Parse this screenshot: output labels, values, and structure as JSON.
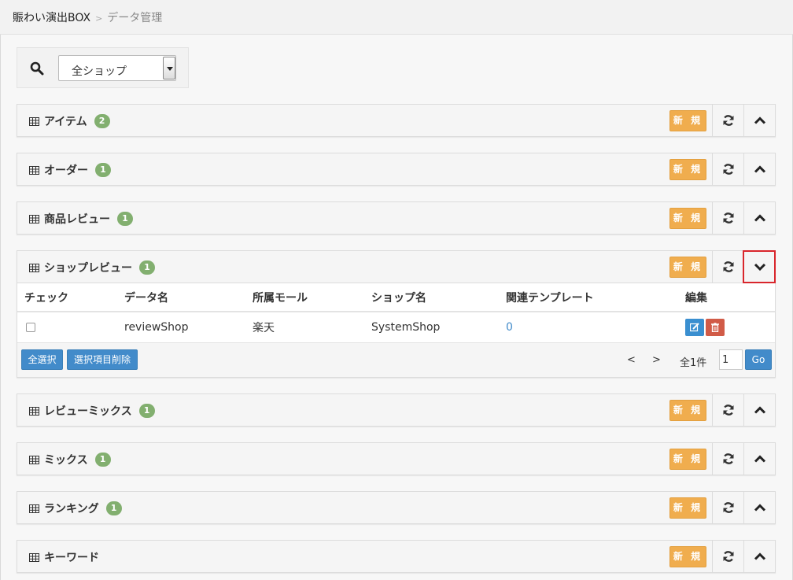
{
  "breadcrumb": {
    "home": "賑わい演出BOX",
    "current": "データ管理"
  },
  "filter": {
    "shop_select": "全ショップ"
  },
  "new_label": "新 規",
  "panels": [
    {
      "title": "アイテム",
      "count": "2"
    },
    {
      "title": "オーダー",
      "count": "1"
    },
    {
      "title": "商品レビュー",
      "count": "1"
    },
    {
      "title": "ショップレビュー",
      "count": "1"
    },
    {
      "title": "レビューミックス",
      "count": "1"
    },
    {
      "title": "ミックス",
      "count": "1"
    },
    {
      "title": "ランキング",
      "count": "1"
    },
    {
      "title": "キーワード",
      "count": ""
    }
  ],
  "table": {
    "headers": [
      "チェック",
      "データ名",
      "所属モール",
      "ショップ名",
      "関連テンプレート",
      "編集"
    ],
    "rows": [
      {
        "name": "reviewShop",
        "mall": "楽天",
        "shop": "SystemShop",
        "templates": "0"
      }
    ]
  },
  "footer": {
    "select_all": "全選択",
    "delete_selected": "選択項目削除",
    "prev": "<",
    "next": ">",
    "total": "全1件",
    "page": "1",
    "go": "Go"
  },
  "colors": {
    "accent_orange": "#f0ad4e",
    "badge_green": "#82af6f",
    "primary_blue": "#428bca",
    "danger_red": "#d15b47",
    "highlight_red": "#d9262c"
  }
}
